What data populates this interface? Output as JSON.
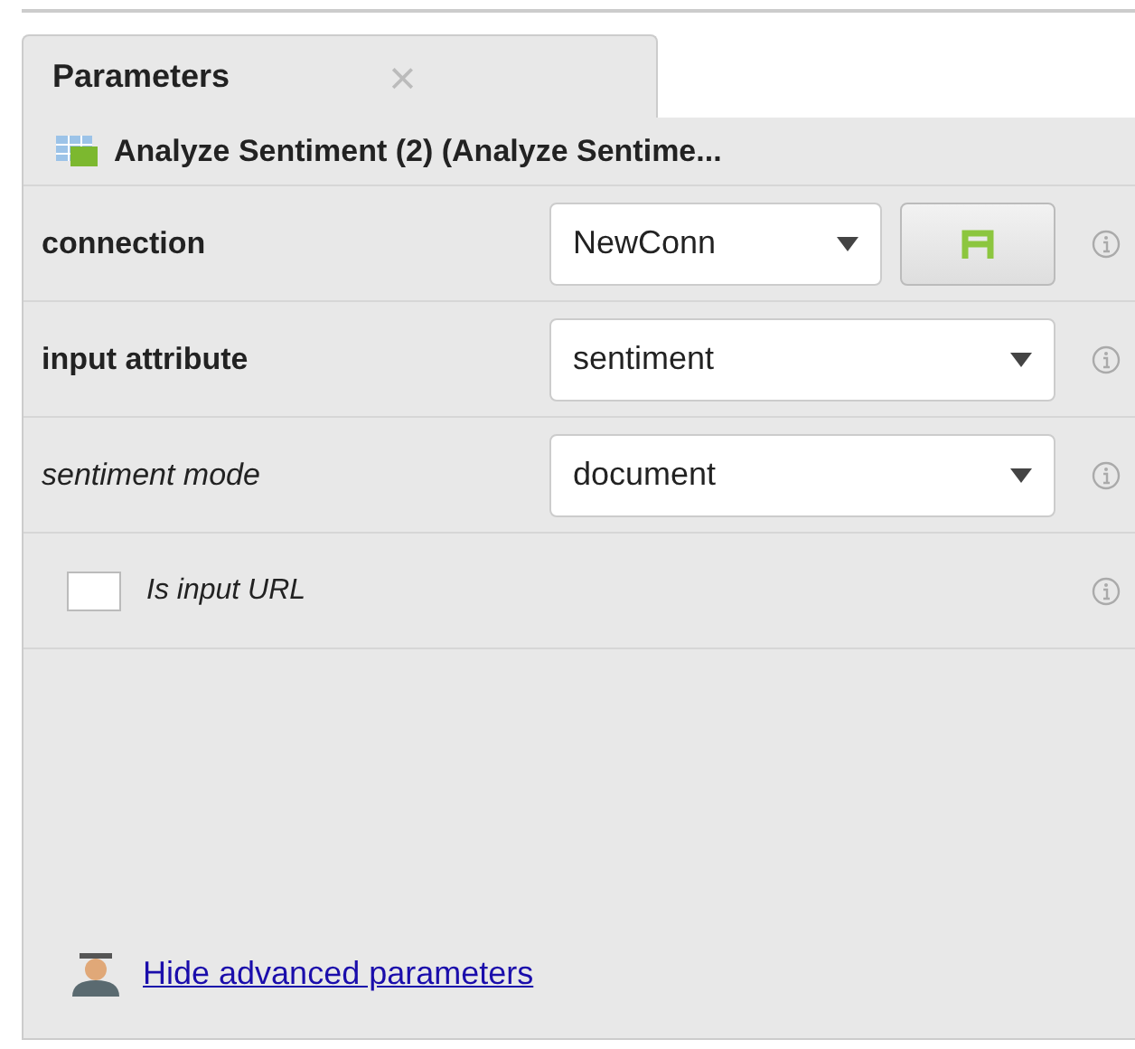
{
  "tabs": [
    {
      "label": "Parameters",
      "close": "×",
      "selected": true
    }
  ],
  "operator": {
    "title": "Analyze Sentiment (2) (Analyze Sentime..."
  },
  "parameters": [
    {
      "kind": "select_with_button",
      "label": "connection",
      "optional": false,
      "value": "NewConn"
    },
    {
      "kind": "select",
      "label": "input attribute",
      "optional": false,
      "value": "sentiment"
    },
    {
      "kind": "select",
      "label": "sentiment mode",
      "optional": true,
      "value": "document"
    },
    {
      "kind": "checkbox",
      "label": "Is input URL",
      "optional": true,
      "checked": false
    }
  ],
  "footer_link": "Hide advanced parameters"
}
